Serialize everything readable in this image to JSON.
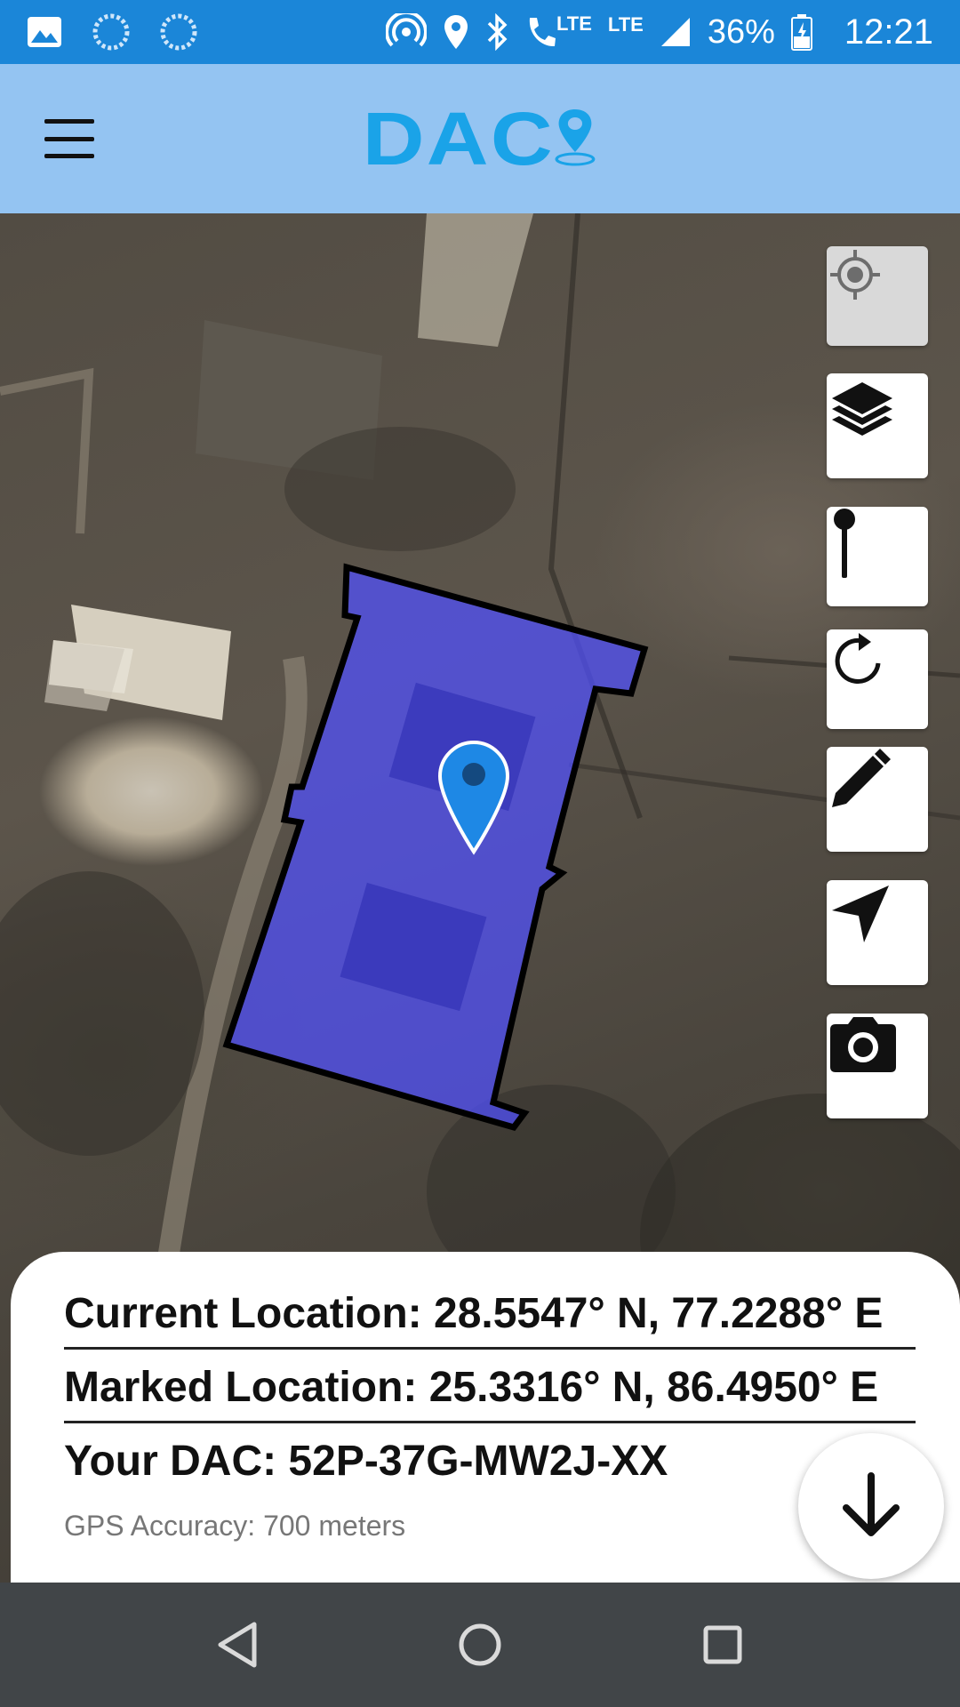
{
  "status_bar": {
    "lte_label_1": "LTE",
    "lte_label_2": "LTE",
    "battery_percent": "36%",
    "time": "12:21"
  },
  "header": {
    "logo_text": "DAC"
  },
  "info": {
    "current_location": "Current Location: 28.5547° N, 77.2288° E",
    "marked_location": "Marked Location: 25.3316° N, 86.4950° E",
    "your_dac": "Your DAC: 52P-37G-MW2J-XX",
    "gps_accuracy": "GPS Accuracy: 700 meters"
  },
  "colors": {
    "status_bar": "#1b86d8",
    "header_bg": "#94c4f2",
    "logo": "#1aa3e8",
    "polygon_fill": "#5050ff",
    "marker": "#1e88e5",
    "nav_bar": "#414548"
  },
  "map_controls": [
    "my-location-icon",
    "layers-icon",
    "pin-icon",
    "refresh-icon",
    "pencil-icon",
    "navigation-arrow-icon",
    "camera-icon"
  ]
}
